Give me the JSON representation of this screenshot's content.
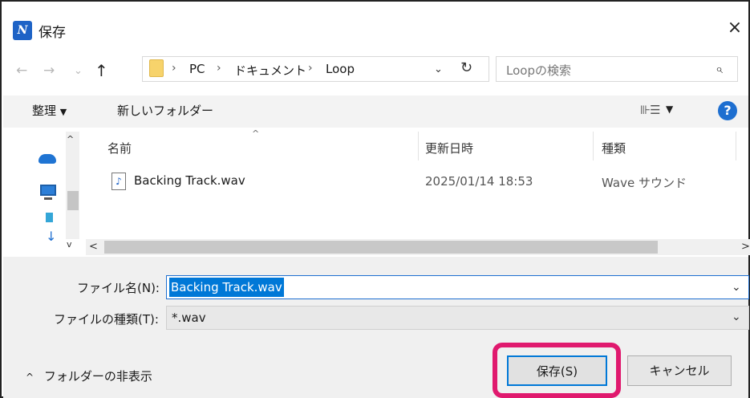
{
  "window": {
    "app_icon": "N",
    "title": "保存",
    "close_glyph": "×"
  },
  "address": {
    "back": "←",
    "forward": "→",
    "history": "⌄",
    "up": "↑",
    "breadcrumb": [
      "PC",
      "ドキュメント",
      "Loop"
    ],
    "separator": "›",
    "dropdown": "⌄",
    "refresh": "↻"
  },
  "search": {
    "placeholder": "Loopの検索",
    "icon": "⌕"
  },
  "toolbar": {
    "organize": "整理",
    "organize_caret": "▼",
    "new_folder": "新しいフォルダー",
    "view_icon": "⊪☰",
    "view_caret": "▼",
    "help": "?"
  },
  "file_list": {
    "sort_indicator": "^",
    "columns": [
      "名前",
      "更新日時",
      "種類"
    ],
    "files": [
      {
        "icon": "♪",
        "name": "Backing Track.wav",
        "date": "2025/01/14 18:53",
        "type": "Wave サウンド"
      }
    ]
  },
  "scroll": {
    "up": "^",
    "down": "v",
    "left": "<",
    "right": ">"
  },
  "form": {
    "filename_label": "ファイル名(N):",
    "filename_value": "Backing Track.wav",
    "filetype_label": "ファイルの種類(T):",
    "filetype_value": "*.wav",
    "caret": "⌄"
  },
  "footer": {
    "hide_folders_caret": "^",
    "hide_folders": "フォルダーの非表示",
    "save_button": "保存(S)",
    "cancel_button": "キャンセル"
  },
  "colors": {
    "accent": "#0078d7",
    "highlight": "#e0196e",
    "help_icon": "#1e6fd0"
  }
}
